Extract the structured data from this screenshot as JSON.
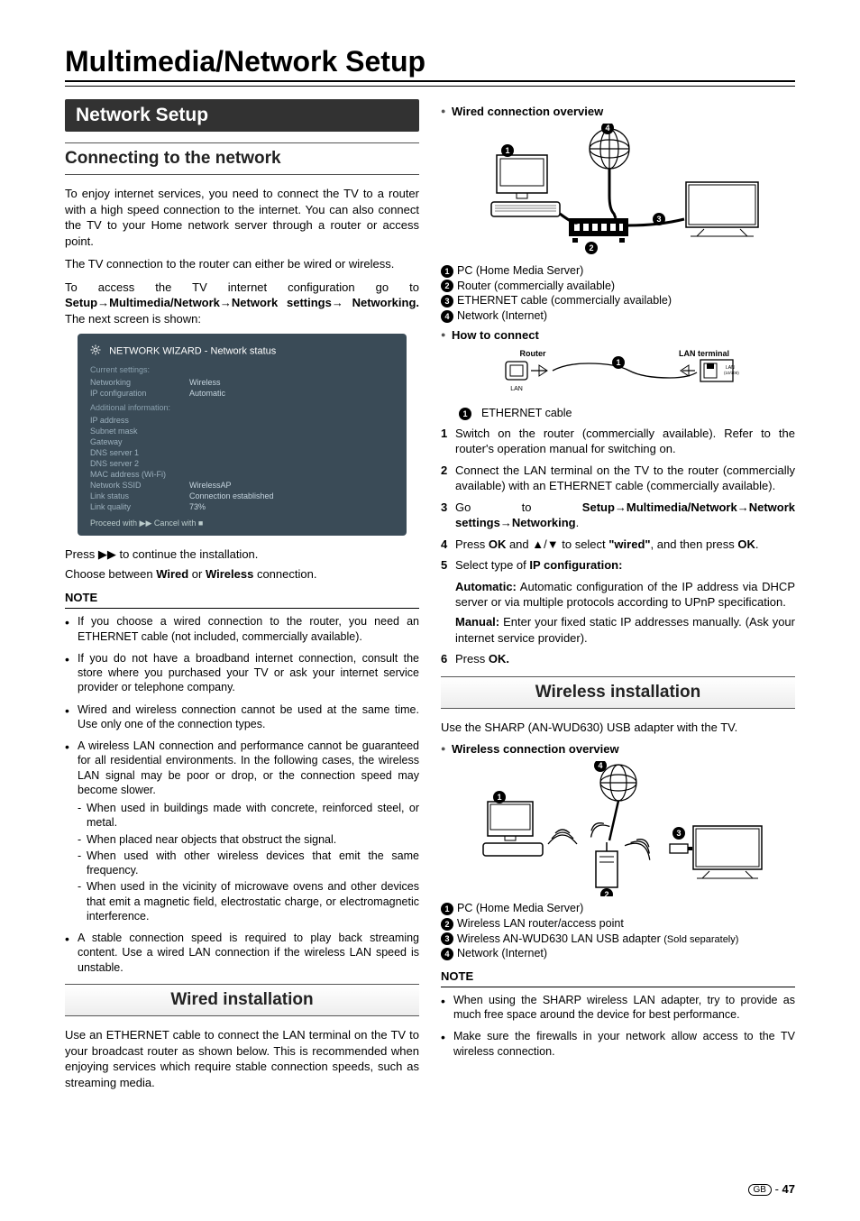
{
  "page": {
    "title": "Multimedia/Network Setup",
    "number": "47",
    "region": "GB"
  },
  "left": {
    "network_setup_heading": "Network Setup",
    "connecting_heading": "Connecting to the network",
    "intro_p1": "To enjoy internet services, you need to connect the TV to a router with a high speed connection to the internet. You can also connect the TV to your Home network server through a router or access point.",
    "intro_p2": "The TV connection to the router can either be wired or wireless.",
    "intro_p3_pre": "To access the TV internet configuration go to ",
    "intro_p3_path": "Setup→Multimedia/Network→Network settings→ Networking.",
    "intro_p3_post": " The next screen is shown:",
    "wizard": {
      "title": "NETWORK WIZARD - Network status",
      "current_label": "Current settings:",
      "rows_current": [
        {
          "k": "Networking",
          "v": "Wireless"
        },
        {
          "k": "IP configuration",
          "v": "Automatic"
        }
      ],
      "additional_label": "Additional information:",
      "rows_additional": [
        {
          "k": "IP address",
          "v": ""
        },
        {
          "k": "Subnet mask",
          "v": ""
        },
        {
          "k": "Gateway",
          "v": ""
        },
        {
          "k": "DNS server 1",
          "v": ""
        },
        {
          "k": "DNS server 2",
          "v": ""
        },
        {
          "k": "MAC address (Wi-Fi)",
          "v": ""
        },
        {
          "k": "Network SSID",
          "v": "WirelessAP"
        },
        {
          "k": "Link status",
          "v": "Connection established"
        },
        {
          "k": "Link quality",
          "v": "73%"
        }
      ],
      "footer": "Proceed with ▶▶    Cancel with ■"
    },
    "press_continue_pre": "Press ",
    "press_continue_icon": "▶▶",
    "press_continue_post": " to continue the installation.",
    "choose_line_pre": "Choose between ",
    "choose_wired": "Wired",
    "choose_or": " or ",
    "choose_wireless": "Wireless",
    "choose_post": " connection.",
    "note_label": "NOTE",
    "notes": [
      "If you choose a wired connection to the router, you need an ETHERNET cable (not included, commercially available).",
      "If you do not have a broadband internet connection, consult the store where you purchased your TV or ask your internet service provider or telephone company.",
      "Wired and wireless connection cannot be used at the same time. Use only one of the connection types."
    ],
    "note_lan_lead": "A wireless LAN connection and performance cannot be guaranteed for all residential environments. In the following cases, the wireless LAN signal may be poor or drop, or the connection speed may become slower.",
    "note_lan_dashes": [
      "When used in buildings made with concrete, reinforced steel, or metal.",
      "When placed near objects that obstruct the signal.",
      "When used with other wireless devices that emit the same frequency.",
      "When used in the vicinity of microwave ovens and other devices that emit a magnetic field, electrostatic charge, or electromagnetic interference."
    ],
    "note_stable": "A stable connection speed is required to play back streaming content. Use a wired LAN connection if the wireless LAN speed is unstable.",
    "wired_install_heading": "Wired installation",
    "wired_install_para": "Use an ETHERNET cable to connect the LAN terminal on the TV to your broadcast router as shown below. This is recommended when enjoying services which require stable connection speeds, such as streaming media."
  },
  "right": {
    "wired_overview_label": "Wired connection overview",
    "wired_legend": [
      "PC (Home Media Server)",
      "Router (commercially available)",
      "ETHERNET cable (commercially available)",
      "Network (Internet)"
    ],
    "how_to_connect_label": "How to connect",
    "router_label": "Router",
    "lan_terminal_label": "LAN terminal",
    "lan_caption": "LAN",
    "lan_port_tiny": "LAN\n(10/100)",
    "ethernet_cable_item": "ETHERNET cable",
    "steps": {
      "s1": "Switch on the router (commercially available). Refer to the router's operation manual for switching on.",
      "s2": "Connect the LAN terminal on the TV to the router (commercially available) with an ETHERNET cable (commercially available).",
      "s3_pre": "Go to ",
      "s3_bold": "Setup→Multimedia/Network→Network settings→Networking",
      "s3_post": ".",
      "s4_pre": "Press ",
      "s4_ok1": "OK",
      "s4_mid": " and ",
      "s4_arrows": "▲/▼",
      "s4_mid2": " to select ",
      "s4_wired": "\"wired\"",
      "s4_post": ", and then press ",
      "s4_ok2": "OK",
      "s4_end": ".",
      "s5_pre": "Select type of ",
      "s5_bold": "IP configuration:",
      "auto_label": "Automatic:",
      "auto_text": " Automatic configuration of the IP address via DHCP server or via multiple protocols according to UPnP specification.",
      "manual_label": "Manual:",
      "manual_text": " Enter your fixed static IP addresses manually. (Ask your internet service provider).",
      "s6_pre": "Press ",
      "s6_ok": "OK."
    },
    "wireless_install_heading": "Wireless installation",
    "wireless_use": "Use the SHARP (AN-WUD630) USB adapter with the TV.",
    "wireless_overview_label": "Wireless connection overview",
    "wireless_legend": [
      "PC (Home Media Server)",
      "Wireless LAN router/access point",
      "Wireless AN-WUD630 LAN USB adapter",
      "Network (Internet)"
    ],
    "sold_separately": "(Sold separately)",
    "note_label": "NOTE",
    "wireless_notes": [
      "When using the SHARP wireless LAN adapter, try to provide as much free space around the device for best performance.",
      "Make sure the firewalls in your network allow access to the TV wireless connection."
    ]
  }
}
